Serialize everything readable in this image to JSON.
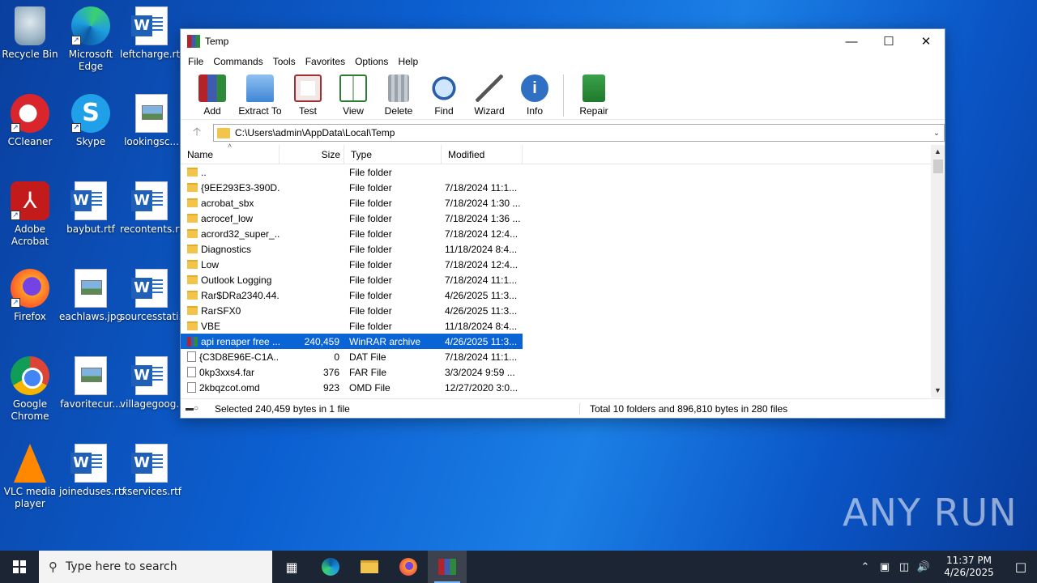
{
  "desktop": {
    "icons": [
      {
        "label": "Recycle Bin"
      },
      {
        "label": "Microsoft Edge"
      },
      {
        "label": "leftcharge.rtf"
      },
      {
        "label": "CCleaner"
      },
      {
        "label": "Skype"
      },
      {
        "label": "lookingsc..."
      },
      {
        "label": "Adobe Acrobat"
      },
      {
        "label": "baybut.rtf"
      },
      {
        "label": "recontents.rtf"
      },
      {
        "label": "Firefox"
      },
      {
        "label": "eachlaws.jpg"
      },
      {
        "label": "sourcesstati..."
      },
      {
        "label": "Google Chrome"
      },
      {
        "label": "favoritecur..."
      },
      {
        "label": "villagegoog..."
      },
      {
        "label": "VLC media player"
      },
      {
        "label": "joineduses.rtf"
      },
      {
        "label": "xservices.rtf"
      }
    ],
    "watermark": "ANY RUN"
  },
  "window": {
    "title": "Temp",
    "menu": [
      "File",
      "Commands",
      "Tools",
      "Favorites",
      "Options",
      "Help"
    ],
    "toolbar": [
      "Add",
      "Extract To",
      "Test",
      "View",
      "Delete",
      "Find",
      "Wizard",
      "Info",
      "Repair"
    ],
    "address": "C:\\Users\\admin\\AppData\\Local\\Temp",
    "columns": {
      "name": "Name",
      "size": "Size",
      "type": "Type",
      "modified": "Modified"
    },
    "rows": [
      {
        "name": "..",
        "size": "",
        "type": "File folder",
        "modified": ""
      },
      {
        "name": "{9EE293E3-390D...",
        "size": "",
        "type": "File folder",
        "modified": "7/18/2024 11:1..."
      },
      {
        "name": "acrobat_sbx",
        "size": "",
        "type": "File folder",
        "modified": "7/18/2024 1:30 ..."
      },
      {
        "name": "acrocef_low",
        "size": "",
        "type": "File folder",
        "modified": "7/18/2024 1:36 ..."
      },
      {
        "name": "acrord32_super_...",
        "size": "",
        "type": "File folder",
        "modified": "7/18/2024 12:4..."
      },
      {
        "name": "Diagnostics",
        "size": "",
        "type": "File folder",
        "modified": "11/18/2024 8:4..."
      },
      {
        "name": "Low",
        "size": "",
        "type": "File folder",
        "modified": "7/18/2024 12:4..."
      },
      {
        "name": "Outlook Logging",
        "size": "",
        "type": "File folder",
        "modified": "7/18/2024 11:1..."
      },
      {
        "name": "Rar$DRa2340.44...",
        "size": "",
        "type": "File folder",
        "modified": "4/26/2025 11:3..."
      },
      {
        "name": "RarSFX0",
        "size": "",
        "type": "File folder",
        "modified": "4/26/2025 11:3..."
      },
      {
        "name": "VBE",
        "size": "",
        "type": "File folder",
        "modified": "11/18/2024 8:4..."
      },
      {
        "name": "api renaper free ...",
        "size": "240,459",
        "type": "WinRAR archive",
        "modified": "4/26/2025 11:3...",
        "selected": true
      },
      {
        "name": "{C3D8E96E-C1A...",
        "size": "0",
        "type": "DAT File",
        "modified": "7/18/2024 11:1..."
      },
      {
        "name": "0kp3xxs4.far",
        "size": "376",
        "type": "FAR File",
        "modified": "3/3/2024 9:59 ..."
      },
      {
        "name": "2kbqzcot.omd",
        "size": "923",
        "type": "OMD File",
        "modified": "12/27/2020 3:0..."
      }
    ],
    "status_left": "Selected 240,459 bytes in 1 file",
    "status_right": "Total 10 folders and 896,810 bytes in 280 files"
  },
  "taskbar": {
    "search_placeholder": "Type here to search",
    "time": "11:37 PM",
    "date": "4/26/2025"
  }
}
